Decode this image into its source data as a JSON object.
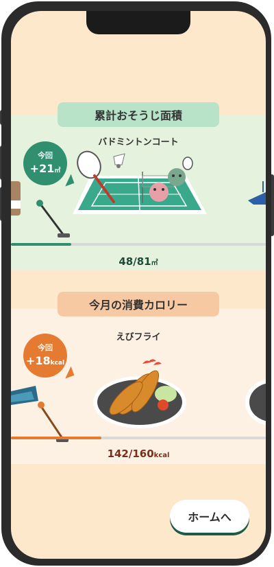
{
  "area_section": {
    "title": "累計おそうじ面積",
    "item_name": "バドミントンコート",
    "badge_label": "今回",
    "badge_value": "+21",
    "badge_unit": "㎡",
    "progress_current": "48",
    "progress_total": "81",
    "progress_unit": "㎡",
    "progress_fraction": 0.59
  },
  "calorie_section": {
    "title": "今月の消費カロリー",
    "item_name": "えびフライ",
    "badge_label": "今回",
    "badge_value": "+18",
    "badge_unit": "kcal",
    "progress_current": "142",
    "progress_total": "160",
    "progress_unit": "kcal",
    "progress_fraction": 0.89
  },
  "home_button": {
    "label": "ホームへ"
  },
  "colors": {
    "green_accent": "#2f8f6e",
    "orange_accent": "#e57a31",
    "page_background": "#fde8cc"
  },
  "icons": [
    "badminton-court-icon",
    "vacuum-cleaner-icon",
    "fried-shrimp-plate-icon",
    "mop-icon",
    "folded-cloth-icon",
    "animal-characters-icon"
  ]
}
